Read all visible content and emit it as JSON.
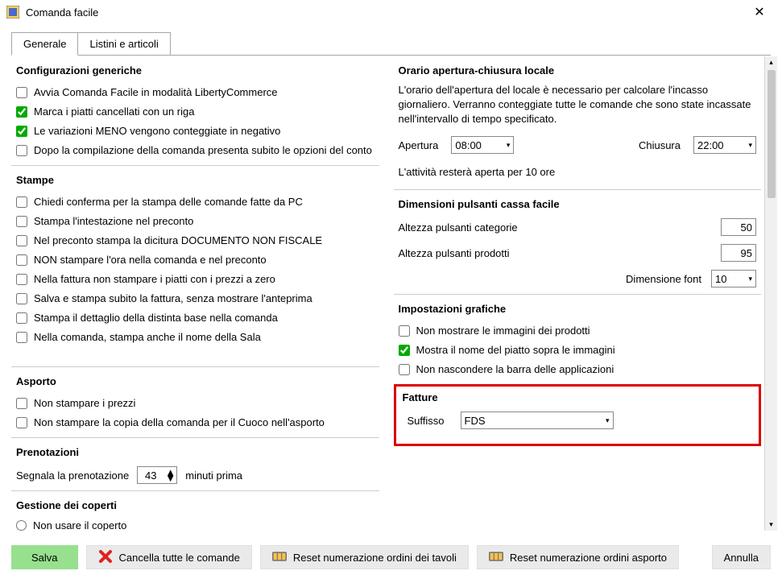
{
  "window": {
    "title": "Comanda facile"
  },
  "tabs": {
    "generale": "Generale",
    "listini": "Listini e articoli"
  },
  "left": {
    "config_title": "Configurazioni generiche",
    "config": {
      "avvia": "Avvia Comanda Facile in modalità LibertyCommerce",
      "marca": "Marca i piatti cancellati con un riga",
      "meno": "Le variazioni MENO vengono conteggiate in negativo",
      "dopo": "Dopo la compilazione della comanda presenta subito le opzioni del conto"
    },
    "stampe_title": "Stampe",
    "stampe": {
      "s1": "Chiedi conferma per la stampa delle comande fatte da PC",
      "s2": "Stampa l'intestazione nel preconto",
      "s3": "Nel preconto stampa la dicitura DOCUMENTO NON FISCALE",
      "s4": "NON stampare l'ora nella comanda e nel preconto",
      "s5": "Nella fattura non stampare i piatti con i prezzi a zero",
      "s6": "Salva e stampa subito la fattura, senza mostrare l'anteprima",
      "s7": "Stampa il dettaglio della distinta base nella comanda",
      "s8": "Nella comanda, stampa anche il nome della Sala"
    },
    "asporto_title": "Asporto",
    "asporto": {
      "a1": "Non stampare i prezzi",
      "a2": "Non stampare la copia della comanda per il Cuoco nell'asporto"
    },
    "prenotazioni_title": "Prenotazioni",
    "pren_label_pre": "Segnala la prenotazione",
    "pren_value": "43",
    "pren_label_post": "minuti prima",
    "coperti_title": "Gestione dei coperti",
    "coperti_opt": "Non usare il coperto"
  },
  "right": {
    "orario_title": "Orario apertura-chiusura locale",
    "orario_desc": "L'orario dell'apertura del locale è necessario per calcolare l'incasso giornaliero. Verranno conteggiate tutte le comande che sono state incassate nell'intervallo di tempo specificato.",
    "apertura_lbl": "Apertura",
    "apertura_val": "08:00",
    "chiusura_lbl": "Chiusura",
    "chiusura_val": "22:00",
    "orario_note": "L'attività resterà aperta per 10 ore",
    "dim_title": "Dimensioni pulsanti cassa facile",
    "dim_cat_lbl": "Altezza pulsanti categorie",
    "dim_cat_val": "50",
    "dim_prod_lbl": "Altezza pulsanti prodotti",
    "dim_prod_val": "95",
    "dim_font_lbl": "Dimensione font",
    "dim_font_val": "10",
    "graf_title": "Impostazioni grafiche",
    "graf": {
      "g1": "Non mostrare le immagini dei prodotti",
      "g2": "Mostra il nome del piatto sopra le immagini",
      "g3": "Non nascondere la barra delle applicazioni"
    },
    "fatture_title": "Fatture",
    "suffisso_lbl": "Suffisso",
    "suffisso_val": "FDS"
  },
  "buttons": {
    "salva": "Salva",
    "cancella": "Cancella tutte le comande",
    "reset_tavoli": "Reset numerazione ordini dei tavoli",
    "reset_asporto": "Reset numerazione ordini asporto",
    "annulla": "Annulla"
  }
}
